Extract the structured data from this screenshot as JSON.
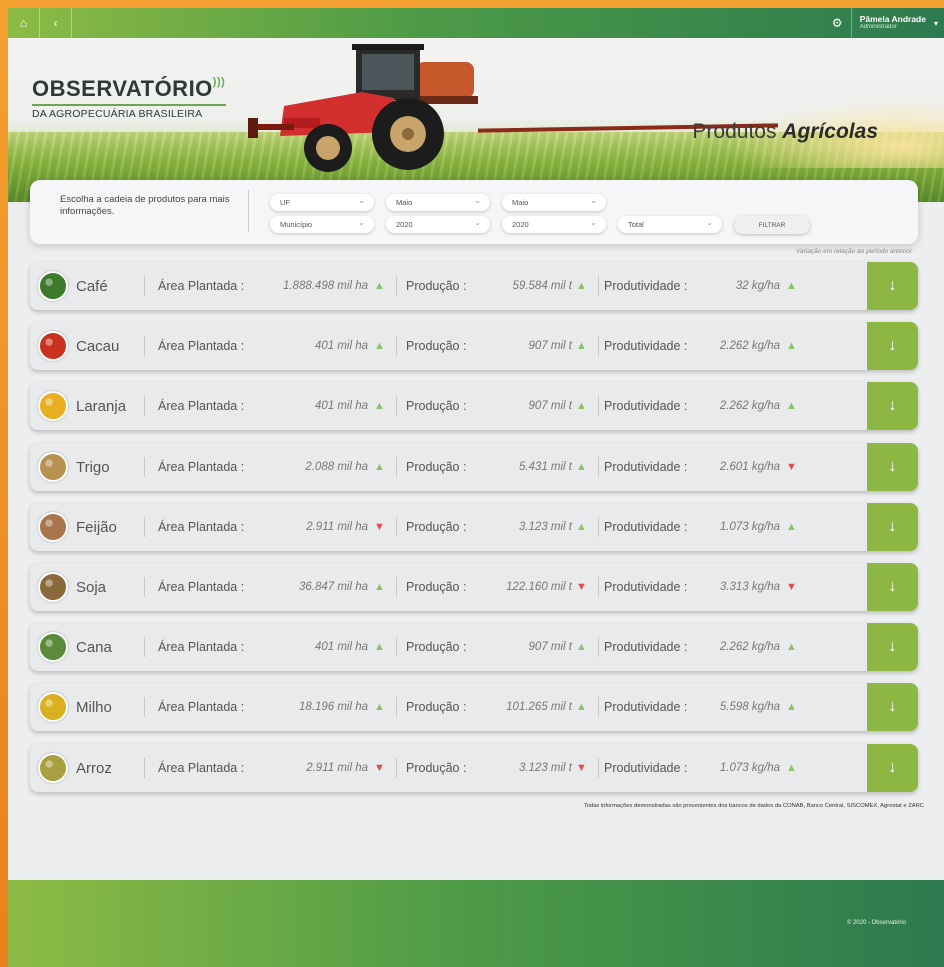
{
  "topbar": {
    "home_icon": "home-icon",
    "back_icon": "chevron-left-icon",
    "settings_icon": "gear-icon",
    "user_name": "Pâmela Andrade",
    "user_role": "Administrador"
  },
  "banner": {
    "logo_line1": "OBSERVATÓRIO",
    "logo_line2": "DA AGROPECUÁRIA BRASILEIRA",
    "title_regular": "Produtos ",
    "title_bold": "Agrícolas"
  },
  "filter": {
    "prompt": "Escolha a cadeia de produtos para mais informações.",
    "uf": "UF",
    "municipio": "Município",
    "month_start": "Maio",
    "year_start": "2020",
    "month_end": "Maio",
    "year_end": "2020",
    "total": "Total",
    "button": "FILTRAR"
  },
  "variation_note": "Variação em relação ao período anterior",
  "labels": {
    "area": "Área Plantada :",
    "producao": "Produção :",
    "produtividade": "Produtividade :"
  },
  "products": [
    {
      "name": "Café",
      "area": "1.888.498 mil ha",
      "area_trend": "up",
      "producao": "59.584 mil t",
      "producao_trend": "up",
      "produtividade": "32 kg/ha",
      "produtividade_trend": "up",
      "color": "#3d7a2a"
    },
    {
      "name": "Cacau",
      "area": "401 mil ha",
      "area_trend": "up",
      "producao": "907 mil t",
      "producao_trend": "up",
      "produtividade": "2.262 kg/ha",
      "produtividade_trend": "up",
      "color": "#c8321e"
    },
    {
      "name": "Laranja",
      "area": "401 mil ha",
      "area_trend": "up",
      "producao": "907 mil t",
      "producao_trend": "up",
      "produtividade": "2.262 kg/ha",
      "produtividade_trend": "up",
      "color": "#e8b020"
    },
    {
      "name": "Trigo",
      "area": "2.088 mil ha",
      "area_trend": "up",
      "producao": "5.431 mil t",
      "producao_trend": "up",
      "produtividade": "2.601 kg/ha",
      "produtividade_trend": "down",
      "color": "#b89050"
    },
    {
      "name": "Feijão",
      "area": "2.911 mil ha",
      "area_trend": "down",
      "producao": "3.123 mil t",
      "producao_trend": "up",
      "produtividade": "1.073 kg/ha",
      "produtividade_trend": "up",
      "color": "#a8764a"
    },
    {
      "name": "Soja",
      "area": "36.847 mil ha",
      "area_trend": "up",
      "producao": "122.160 mil t",
      "producao_trend": "down",
      "produtividade": "3.313 kg/ha",
      "produtividade_trend": "down",
      "color": "#8a6a3a"
    },
    {
      "name": "Cana",
      "area": "401 mil ha",
      "area_trend": "up",
      "producao": "907 mil t",
      "producao_trend": "up",
      "produtividade": "2.262 kg/ha",
      "produtividade_trend": "up",
      "color": "#5a8a3a"
    },
    {
      "name": "Milho",
      "area": "18.196 mil ha",
      "area_trend": "up",
      "producao": "101.265 mil t",
      "producao_trend": "up",
      "produtividade": "5.598 kg/ha",
      "produtividade_trend": "up",
      "color": "#d8b020"
    },
    {
      "name": "Arroz",
      "area": "2.911 mil ha",
      "area_trend": "down",
      "producao": "3.123 mil t",
      "producao_trend": "down",
      "produtividade": "1.073 kg/ha",
      "produtividade_trend": "up",
      "color": "#a8a040"
    }
  ],
  "sources": "Todas informações demonstradas são provenientes dos bancos de dados da CONAB, Banco Central, SISCOMEX, Agrostat e ZARC",
  "footer": {
    "copyright": "© 2020 - Observatório"
  },
  "colors": {
    "accent_green": "#8bb742",
    "trend_up": "#8dc26a",
    "trend_down": "#e84c4c"
  }
}
